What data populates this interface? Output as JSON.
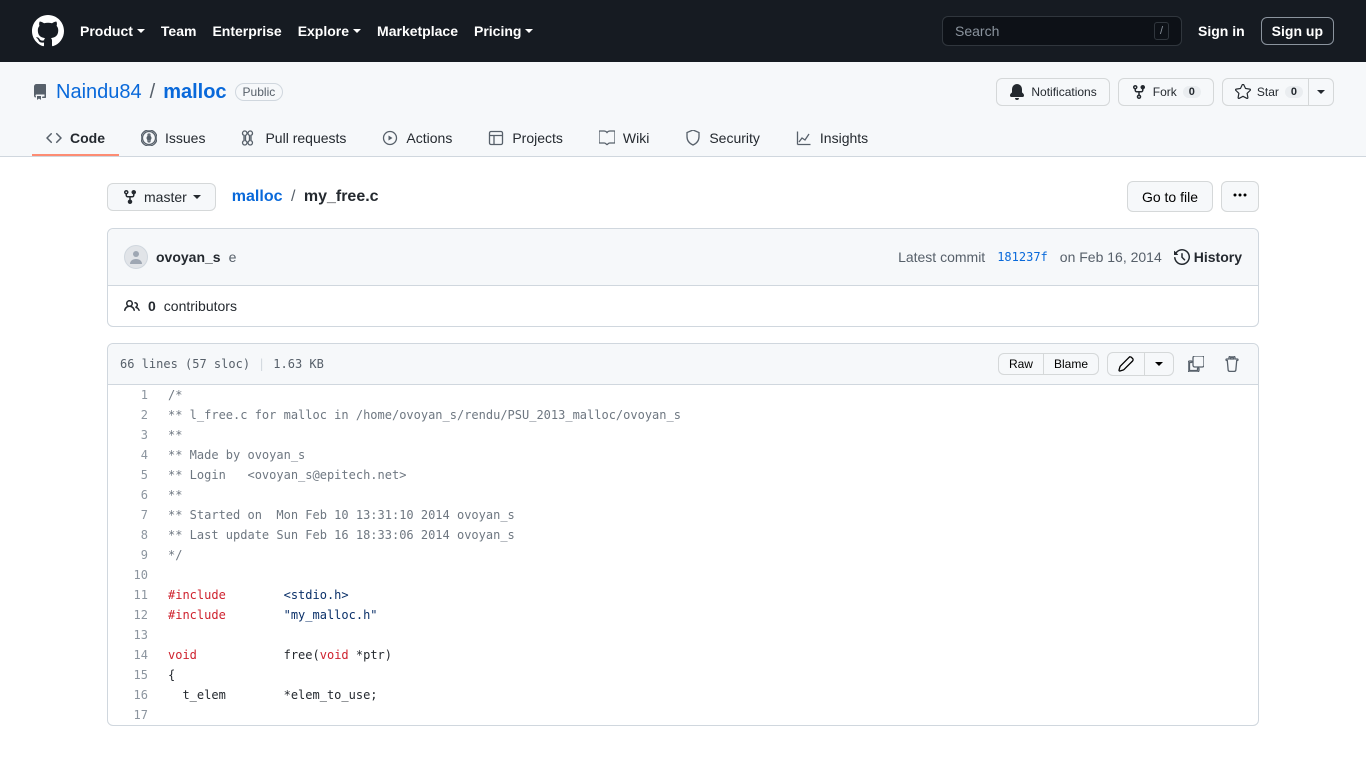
{
  "header": {
    "nav": [
      "Product",
      "Team",
      "Enterprise",
      "Explore",
      "Marketplace",
      "Pricing"
    ],
    "search_placeholder": "Search",
    "signin": "Sign in",
    "signup": "Sign up"
  },
  "repo": {
    "owner": "Naindu84",
    "name": "malloc",
    "visibility": "Public",
    "actions": {
      "notifications": "Notifications",
      "fork": "Fork",
      "fork_count": "0",
      "star": "Star",
      "star_count": "0"
    },
    "tabs": [
      "Code",
      "Issues",
      "Pull requests",
      "Actions",
      "Projects",
      "Wiki",
      "Security",
      "Insights"
    ]
  },
  "file_nav": {
    "branch": "master",
    "path_root": "malloc",
    "path_current": "my_free.c",
    "go_to_file": "Go to file"
  },
  "commit": {
    "author": "ovoyan_s",
    "message": "e",
    "latest_label": "Latest commit",
    "sha": "181237f",
    "date": "on Feb 16, 2014",
    "history": "History",
    "contributors_count": "0",
    "contributors_label": "contributors"
  },
  "file": {
    "lines_info": "66 lines (57 sloc)",
    "size": "1.63 KB",
    "raw": "Raw",
    "blame": "Blame"
  },
  "code_lines": [
    {
      "n": "1",
      "html": "<span class='pl-c'>/*</span>"
    },
    {
      "n": "2",
      "html": "<span class='pl-c'>** l_free.c for malloc in /home/ovoyan_s/rendu/PSU_2013_malloc/ovoyan_s</span>"
    },
    {
      "n": "3",
      "html": "<span class='pl-c'>**</span>"
    },
    {
      "n": "4",
      "html": "<span class='pl-c'>** Made by ovoyan_s</span>"
    },
    {
      "n": "5",
      "html": "<span class='pl-c'>** Login   &lt;ovoyan_s@epitech.net&gt;</span>"
    },
    {
      "n": "6",
      "html": "<span class='pl-c'>**</span>"
    },
    {
      "n": "7",
      "html": "<span class='pl-c'>** Started on  Mon Feb 10 13:31:10 2014 ovoyan_s</span>"
    },
    {
      "n": "8",
      "html": "<span class='pl-c'>** Last update Sun Feb 16 18:33:06 2014 ovoyan_s</span>"
    },
    {
      "n": "9",
      "html": "<span class='pl-c'>*/</span>"
    },
    {
      "n": "10",
      "html": ""
    },
    {
      "n": "11",
      "html": "<span class='pl-k'>#include</span>        <span class='pl-s'>&lt;stdio.h&gt;</span>"
    },
    {
      "n": "12",
      "html": "<span class='pl-k'>#include</span>        <span class='pl-s'>\"my_malloc.h\"</span>"
    },
    {
      "n": "13",
      "html": ""
    },
    {
      "n": "14",
      "html": "<span class='pl-k'>void</span>            <span>free</span>(<span class='pl-k'>void</span> *ptr)"
    },
    {
      "n": "15",
      "html": "{"
    },
    {
      "n": "16",
      "html": "  t_elem        *elem_to_use;"
    },
    {
      "n": "17",
      "html": ""
    }
  ]
}
